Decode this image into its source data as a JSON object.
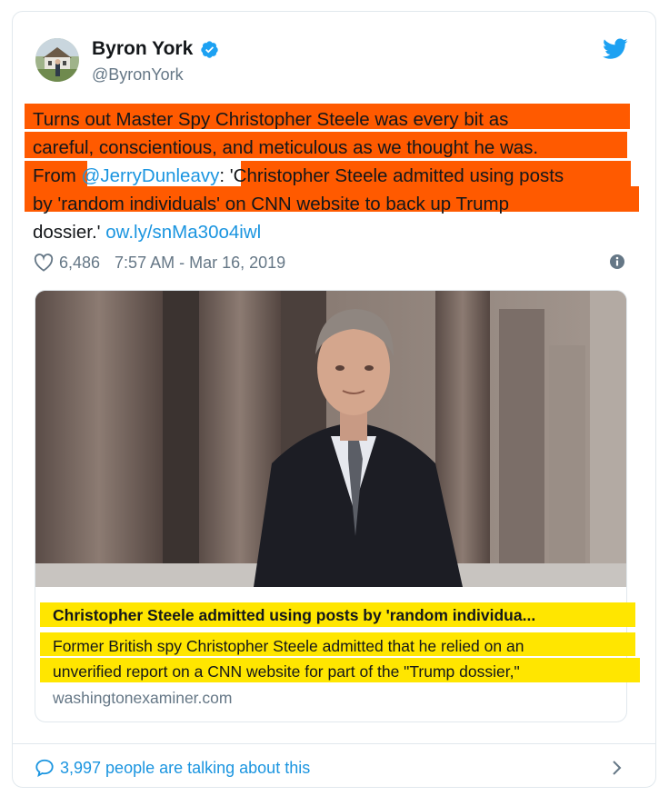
{
  "author": {
    "name": "Byron York",
    "handle": "@ByronYork"
  },
  "tweet": {
    "lines": [
      "Turns out Master Spy Christopher Steele was every bit as",
      "careful, conscientious, and meticulous as we thought he was."
    ],
    "line3_prefix": "From ",
    "mention": "@JerryDunleavy",
    "line3_suffix": ": 'Christopher Steele admitted using posts",
    "line4": "by 'random individuals' on CNN website to back up Trump",
    "line5_prefix": "dossier.' ",
    "link": "ow.ly/snMa30o4iwl",
    "likes": "6,486",
    "timestamp": "7:57 AM - Mar 16, 2019"
  },
  "link_card": {
    "title": "Christopher Steele admitted using posts by 'random individua...",
    "description_lines": [
      "Former British spy Christopher Steele admitted that he relied on an",
      "unverified report on a CNN website for part of the \"Trump dossier,\""
    ],
    "domain": "washingtonexaminer.com"
  },
  "footer": {
    "talking": "3,997 people are talking about this"
  },
  "colors": {
    "highlight_orange": "#ff5a00",
    "highlight_yellow": "#ffe600",
    "twitter_blue": "#1da1f2",
    "link_blue": "#1b95e0"
  },
  "icons": [
    "avatar",
    "verified-badge-icon",
    "twitter-bird-icon",
    "heart-icon",
    "info-icon",
    "comment-bubble-icon",
    "chevron-right-icon"
  ]
}
